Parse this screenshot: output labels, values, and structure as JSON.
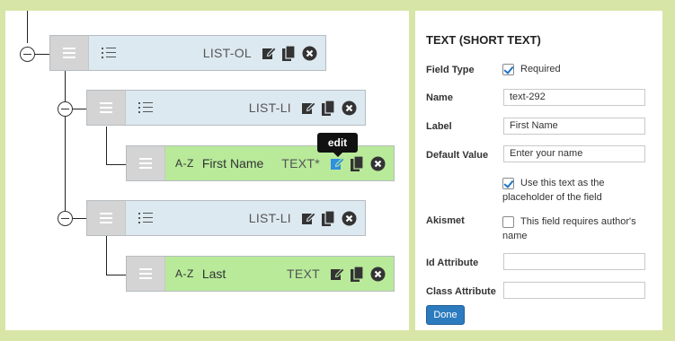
{
  "tree": {
    "rows": [
      {
        "type_label": "LIST-OL",
        "field_label": ""
      },
      {
        "type_label": "LIST-LI",
        "field_label": ""
      },
      {
        "type_label": "TEXT*",
        "field_label": "First Name",
        "az": "A-Z"
      },
      {
        "type_label": "LIST-LI",
        "field_label": ""
      },
      {
        "type_label": "TEXT",
        "field_label": "Last",
        "az": "A-Z"
      }
    ],
    "tooltip": "edit"
  },
  "settings": {
    "title": "TEXT (SHORT TEXT)",
    "field_type_label": "Field Type",
    "required_label": "Required",
    "required_checked": true,
    "name_label": "Name",
    "name_value": "text-292",
    "label_label": "Label",
    "label_value": "First Name",
    "default_value_label": "Default Value",
    "default_value_value": "Enter your name",
    "placeholder_line1": "Use this text as the",
    "placeholder_line2": "placeholder of the field",
    "placeholder_checked": true,
    "akismet_label": "Akismet",
    "akismet_line1": "This field requires author's",
    "akismet_line2": "name",
    "akismet_checked": false,
    "id_attribute_label": "Id Attribute",
    "id_attribute_value": "",
    "class_attribute_label": "Class Attribute",
    "class_attribute_value": "",
    "done_label": "Done"
  },
  "colors": {
    "background": "#d7e6a6",
    "row_blue": "#dde9f0",
    "row_green": "#b8ea9a",
    "active_edit_icon": "#2f8fe0",
    "done_button": "#2d7bbf"
  }
}
